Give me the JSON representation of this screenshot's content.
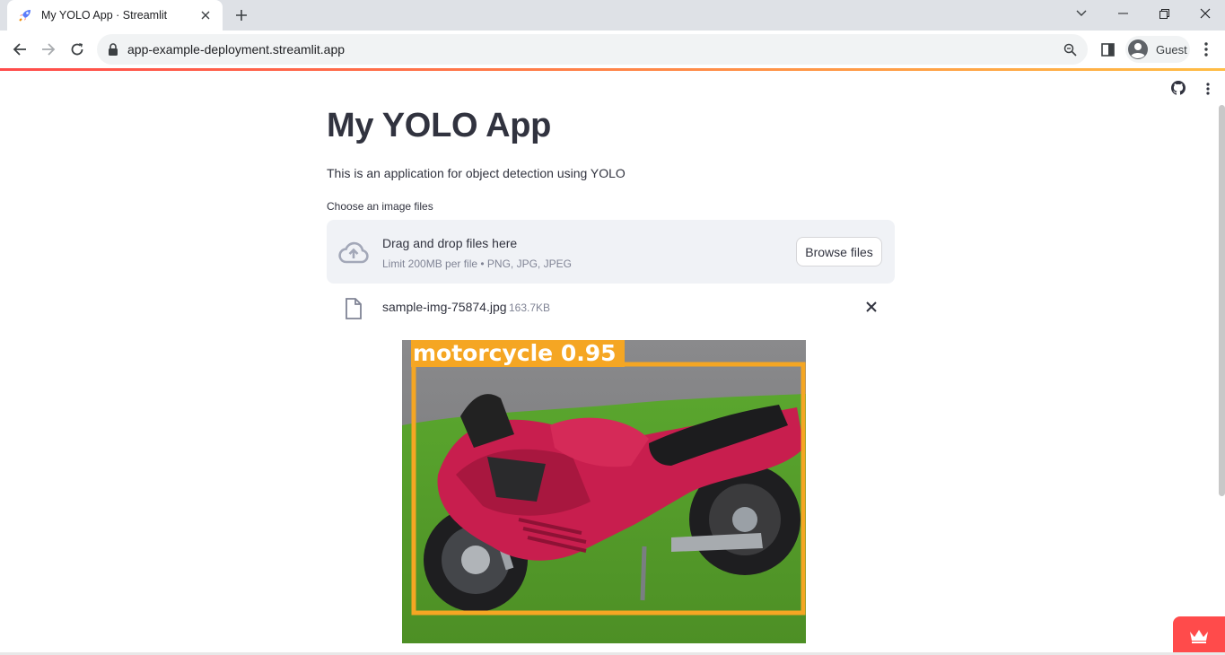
{
  "browser": {
    "tab_title": "My YOLO App · Streamlit",
    "url": "app-example-deployment.streamlit.app",
    "profile_name": "Guest"
  },
  "app": {
    "title": "My YOLO App",
    "description": "This is an application for object detection using YOLO",
    "uploader": {
      "label": "Choose an image files",
      "drop_title": "Drag and drop files here",
      "limit_text": "Limit 200MB per file • PNG, JPG, JPEG",
      "browse_label": "Browse files"
    },
    "uploaded_file": {
      "name": "sample-img-75874.jpg",
      "size": "163.7KB"
    },
    "detection": {
      "label": "motorcycle  0.95",
      "box_color": "#f5a623"
    }
  },
  "colors": {
    "accent": "#ff4b4b",
    "dropzone_bg": "#f0f2f6"
  }
}
